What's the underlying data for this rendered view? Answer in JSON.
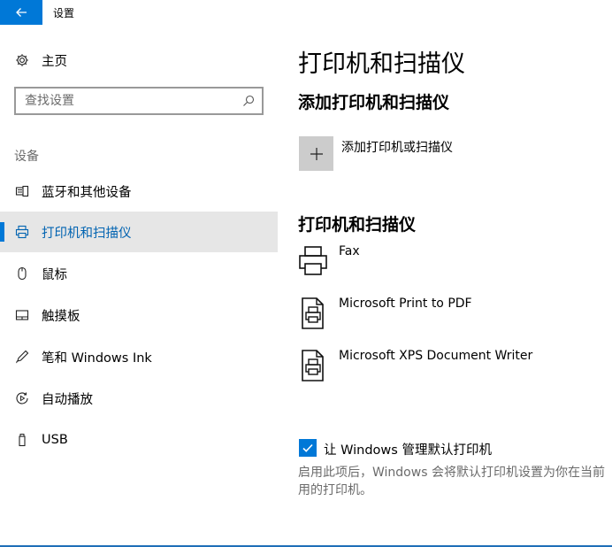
{
  "window": {
    "title": "设置"
  },
  "sidebar": {
    "home": {
      "label": "主页",
      "icon": "gear-icon"
    },
    "search": {
      "placeholder": "查找设置",
      "value": "",
      "icon": "search-icon"
    },
    "section_heading": "设备",
    "items": [
      {
        "label": "蓝牙和其他设备",
        "icon": "bluetooth-devices-icon",
        "selected": false
      },
      {
        "label": "打印机和扫描仪",
        "icon": "printer-icon",
        "selected": true
      },
      {
        "label": "鼠标",
        "icon": "mouse-icon",
        "selected": false
      },
      {
        "label": "触摸板",
        "icon": "touchpad-icon",
        "selected": false
      },
      {
        "label": "笔和 Windows Ink",
        "icon": "pen-icon",
        "selected": false
      },
      {
        "label": "自动播放",
        "icon": "autoplay-icon",
        "selected": false
      },
      {
        "label": "USB",
        "icon": "usb-icon",
        "selected": false
      }
    ]
  },
  "main": {
    "title": "打印机和扫描仪",
    "add_section": {
      "heading": "添加打印机和扫描仪",
      "add_label": "添加打印机或扫描仪"
    },
    "list_section": {
      "heading": "打印机和扫描仪",
      "devices": [
        {
          "name": "Fax",
          "icon": "fax-printer-icon"
        },
        {
          "name": "Microsoft Print to PDF",
          "icon": "pdf-printer-icon"
        },
        {
          "name": "Microsoft XPS Document Writer",
          "icon": "xps-printer-icon"
        }
      ]
    },
    "default_printer": {
      "checked": true,
      "label": "让 Windows 管理默认打印机",
      "description_line1": "启用此项后，Windows 会将默认打印机设置为你在当前",
      "description_line2": "用的打印机。"
    }
  },
  "colors": {
    "accent": "#0078d7",
    "selected_bg": "#e6e6e6",
    "tile_bg": "#cccccc",
    "secondary_text": "#6b6b6b"
  }
}
